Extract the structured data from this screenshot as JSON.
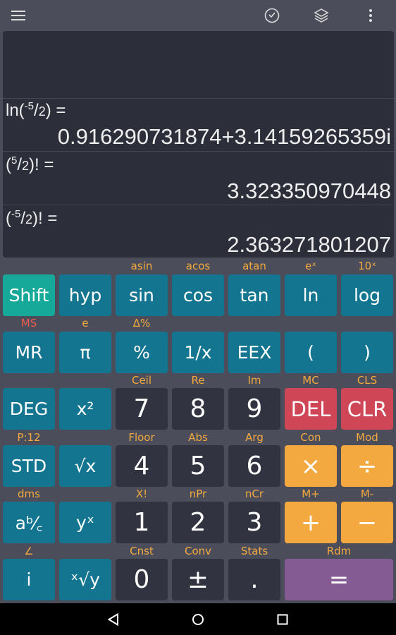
{
  "topbar": {
    "icons": [
      "menu-icon",
      "history-icon",
      "layers-icon",
      "more-vert-icon"
    ]
  },
  "display": {
    "history": [
      {
        "expr_prefix": "ln(",
        "num": "-5",
        "den": "2",
        "expr_suffix": ") =",
        "result": "0.916290731874+3.14159265359i"
      },
      {
        "expr_prefix": "(",
        "num": "5",
        "den": "2",
        "expr_suffix": ")! =",
        "result": "3.323350970448"
      },
      {
        "expr_prefix": "(",
        "num": "-5",
        "den": "2",
        "expr_suffix": ")! =",
        "result": "2.363271801207"
      }
    ]
  },
  "keypad": {
    "rows": [
      {
        "labels": [
          "",
          "",
          "asin",
          "acos",
          "atan",
          "eˣ",
          "10ˣ"
        ],
        "keys": [
          "Shift",
          "hyp",
          "sin",
          "cos",
          "tan",
          "ln",
          "log"
        ]
      },
      {
        "labels": [
          "MS",
          "e",
          "Δ%",
          "",
          "",
          "",
          ""
        ],
        "keys": [
          "MR",
          "π",
          "%",
          "1/x",
          "EEX",
          "(",
          ")"
        ]
      },
      {
        "labels": [
          "",
          "",
          "Ceil",
          "Re",
          "Im",
          "MC",
          "CLS"
        ],
        "keys": [
          "DEG",
          "x²",
          "7",
          "8",
          "9",
          "DEL",
          "CLR"
        ]
      },
      {
        "labels": [
          "P:12",
          "",
          "Floor",
          "Abs",
          "Arg",
          "Con",
          "Mod"
        ],
        "keys": [
          "STD",
          "√x",
          "4",
          "5",
          "6",
          "×",
          "÷"
        ]
      },
      {
        "labels": [
          "dms",
          "",
          "X!",
          "nPr",
          "nCr",
          "M+",
          "M-"
        ],
        "keys": [
          "aᵇ⁄꜀",
          "yˣ",
          "1",
          "2",
          "3",
          "+",
          "−"
        ]
      },
      {
        "labels": [
          "∠",
          "",
          "Cnst",
          "Conv",
          "Stats",
          "Rdm"
        ],
        "keys": [
          "i",
          "ˣ√y",
          "0",
          "±",
          ".",
          "="
        ]
      }
    ]
  },
  "colors": {
    "function_key": "#137590",
    "shift_key": "#16a899",
    "digit_key": "#313440",
    "clear_key": "#cf4757",
    "operator_key": "#f3a93f",
    "equals_key": "#855b94",
    "secondary_label": "#f3a93f",
    "memory_store_label": "#ee5a4f"
  },
  "navbar": {
    "icons": [
      "back-icon",
      "home-icon",
      "recents-icon"
    ]
  }
}
